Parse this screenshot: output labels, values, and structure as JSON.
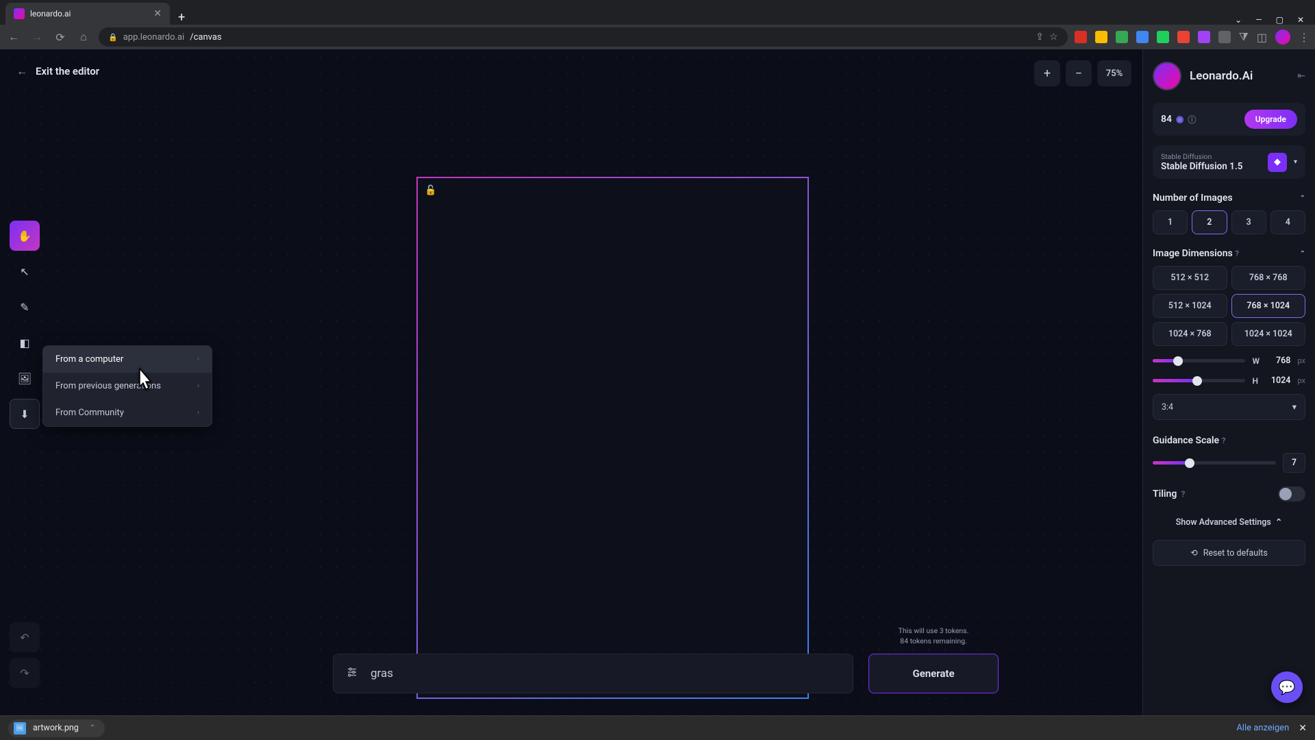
{
  "browser": {
    "tab_title": "leonardo.ai",
    "url_host": "app.leonardo.ai",
    "url_path": "/canvas"
  },
  "app": {
    "exit_label": "Exit the editor",
    "zoom_value": "75%"
  },
  "context_menu": {
    "items": [
      "From a computer",
      "From previous generations",
      "From Community"
    ]
  },
  "prompt": {
    "value": "gras",
    "token_line1": "This will use 3 tokens.",
    "token_line2": "84 tokens remaining.",
    "generate_label": "Generate"
  },
  "right_panel": {
    "brand": "Leonardo.Ai",
    "credits": "84",
    "upgrade_label": "Upgrade",
    "model_sub": "Stable Diffusion",
    "model_name": "Stable Diffusion 1.5",
    "num_images_label": "Number of Images",
    "num_images": [
      "1",
      "2",
      "3",
      "4"
    ],
    "num_images_selected": "2",
    "dim_label": "Image Dimensions",
    "dims": [
      "512 × 512",
      "768 × 768",
      "512 × 1024",
      "768 × 1024",
      "1024 × 768",
      "1024 × 1024"
    ],
    "dim_selected": "768 × 1024",
    "width_label": "W",
    "width_val": "768",
    "height_label": "H",
    "height_val": "1024",
    "px_unit": "px",
    "ratio": "3:4",
    "guidance_label": "Guidance Scale",
    "guidance_val": "7",
    "tiling_label": "Tiling",
    "adv_label": "Show Advanced Settings",
    "reset_label": "Reset to defaults"
  },
  "download": {
    "filename": "artwork.png",
    "show_all": "Alle anzeigen"
  }
}
